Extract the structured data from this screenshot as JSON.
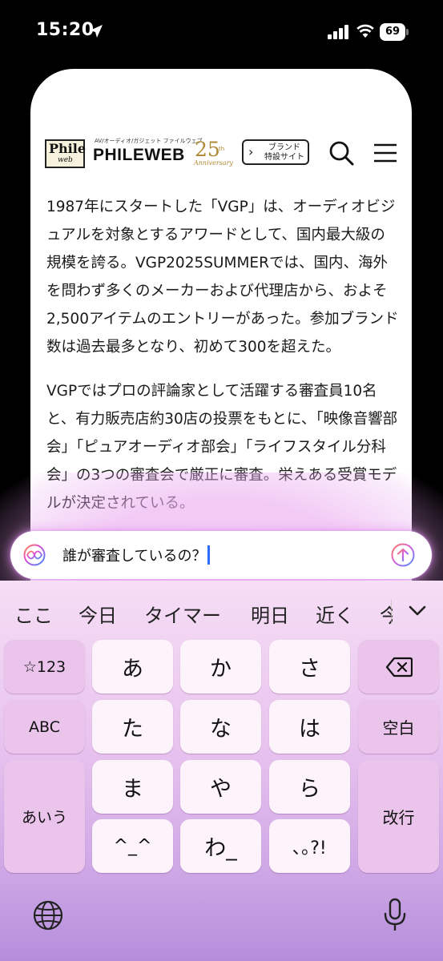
{
  "status_bar": {
    "time": "15:20",
    "battery": "69"
  },
  "site": {
    "logo_box_top": "Phile",
    "logo_box_bottom": "web",
    "tagline": "AV/オーディオ/ガジェット ファイルウェブ",
    "brand_name": "PHILEWEB",
    "anniversary_number": "25",
    "anniversary_suffix": "th",
    "anniversary_text": "Anniversary",
    "brand_button_line1": "ブランド",
    "brand_button_line2": "特設サイト",
    "search_icon": "search-icon",
    "menu_icon": "hamburger-menu-icon"
  },
  "article": {
    "paragraphs": [
      "1987年にスタートした「VGP」は、オーディオビジュアルを対象とするアワードとして、国内最大級の規模を誇る。VGP2025SUMMERでは、国内、海外を問わず多くのメーカーおよび代理店から、およそ2,500アイテムのエントリーがあった。参加ブランド数は過去最多となり、初めて300を超えた。",
      "VGPではプロの評論家として活躍する審査員10名と、有力販売店約30店の投票をもとに、「映像音響部会」「ピュアオーディオ部会」「ライフスタイル分科会」の3つの審査会で厳正に審査。栄えある受賞モデルが決定されている。"
    ]
  },
  "assistant_input": {
    "text": "誰が審査しているの？"
  },
  "keyboard": {
    "suggestions": [
      "ここ",
      "今日",
      "タイマー",
      "明日",
      "近く",
      "今"
    ],
    "keys": {
      "numbers": "☆123",
      "a": "あ",
      "ka": "か",
      "sa": "さ",
      "abc": "ABC",
      "ta": "た",
      "na": "な",
      "ha": "は",
      "space": "空白",
      "aiu": "あいう",
      "ma": "ま",
      "ya": "や",
      "ra": "ら",
      "enter": "改行",
      "emoticon": "^_^",
      "wa": "わ_",
      "punct": "､｡?!"
    }
  },
  "colors": {
    "caret": "#2f6bff",
    "gold": "#b08a35",
    "keyboard_bg": "#e7c2ee"
  }
}
